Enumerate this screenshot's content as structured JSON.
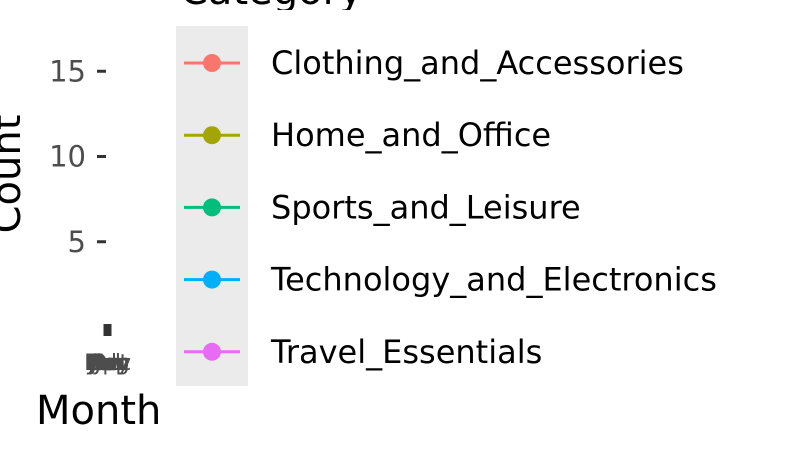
{
  "chart_data": {
    "type": "line",
    "title": "",
    "xlabel": "Month",
    "ylabel": "Count",
    "y_ticks": [
      5,
      10,
      15
    ],
    "ylim": [
      0,
      17
    ],
    "x_tick_labels": [
      "Jan",
      "Feb",
      "Mar",
      "Apr",
      "May",
      "Jun",
      "Jul",
      "Aug",
      "Sep",
      "Oct",
      "Nov",
      "Dec"
    ],
    "legend": {
      "title": "Category",
      "placement": "right",
      "entries": [
        {
          "name": "Clothing_and_Accessories",
          "color": "#F8766D"
        },
        {
          "name": "Home_and_Office",
          "color": "#A3A500"
        },
        {
          "name": "Sports_and_Leisure",
          "color": "#00BF7D"
        },
        {
          "name": "Technology_and_Electronics",
          "color": "#00B0F6"
        },
        {
          "name": "Travel_Essentials",
          "color": "#E76BF3"
        }
      ]
    },
    "panel_background": "#EBEBEB",
    "grid": false
  }
}
